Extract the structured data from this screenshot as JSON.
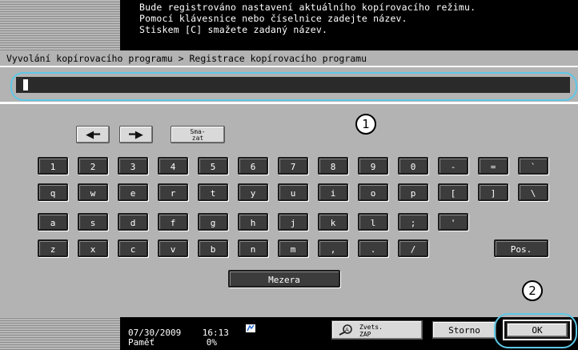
{
  "message": {
    "lines": [
      "Bude registrováno nastavení aktuálního kopírovacího režimu.",
      "Pomocí klávesnice nebo číselnice zadejte název.",
      "Stiskem [C] smažete zadaný název."
    ]
  },
  "breadcrumb": "Vyvolání kopírovacího programu > Registrace kopírovacího programu",
  "input": {
    "value": ""
  },
  "callouts": {
    "one": "1",
    "two": "2"
  },
  "keyboard": {
    "delete_label": "Sma-\nzat",
    "row_numbers": [
      "1",
      "2",
      "3",
      "4",
      "5",
      "6",
      "7",
      "8",
      "9",
      "0",
      "-",
      "=",
      "`"
    ],
    "row_q": [
      "q",
      "w",
      "e",
      "r",
      "t",
      "y",
      "u",
      "i",
      "o",
      "p",
      "[",
      "]",
      "\\"
    ],
    "row_a": [
      "a",
      "s",
      "d",
      "f",
      "g",
      "h",
      "j",
      "k",
      "l",
      ";",
      "'"
    ],
    "row_z": [
      "z",
      "x",
      "c",
      "v",
      "b",
      "n",
      "m",
      ",",
      ".",
      "/"
    ],
    "shift_label": "Pos.",
    "space_label": "Mezera"
  },
  "status": {
    "date": "07/30/2009",
    "time": "16:13",
    "memory_label": "Paměť",
    "memory_value": "0%"
  },
  "buttons": {
    "zoom_label": "Zvets.\nZAP",
    "cancel": "Storno",
    "ok": "OK"
  }
}
